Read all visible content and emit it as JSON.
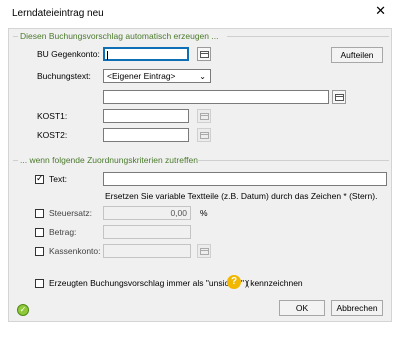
{
  "window": {
    "title": "Lerndateieintrag neu",
    "close_glyph": "✕"
  },
  "section1": {
    "title": "Diesen Buchungsvorschlag automatisch erzeugen ...",
    "bu_label": "BU Gegenkonto:",
    "bu_value": "",
    "buchungstext_label": "Buchungstext:",
    "buchungstext_selected": "<Eigener Eintrag>",
    "buchungstext_value": "",
    "kost1_label": "KOST1:",
    "kost1_value": "",
    "kost2_label": "KOST2:",
    "kost2_value": "",
    "aufteilen_label": "Aufteilen"
  },
  "section2": {
    "title": "... wenn folgende Zuordnungskriterien zutreffen",
    "text_label": "Text:",
    "text_checked": true,
    "text_value": "",
    "hint": "Ersetzen Sie variable Textteile (z.B. Datum) durch das Zeichen * (Stern).",
    "steuersatz_label": "Steuersatz:",
    "steuersatz_value": "0,00",
    "percent": "%",
    "betrag_label": "Betrag:",
    "betrag_value": "",
    "kassenkonto_label": "Kassenkonto:",
    "kassenkonto_value": ""
  },
  "unsicher": {
    "label_pre": "Erzeugten Buchungsvorschlag immer als \"unsicher\" (",
    "help_glyph": "?",
    "label_post": ") kennzeichnen"
  },
  "footer": {
    "ok_label": "OK",
    "abbrechen_label": "Abbrechen"
  },
  "icons": {
    "picker": "calendar-list-icon",
    "help": "question-icon",
    "status": "green-status-icon",
    "chevron": "chevron-down-icon"
  },
  "colors": {
    "section_title": "#4a7a2c",
    "focus": "#0f6fb5",
    "help": "#f2b700"
  }
}
